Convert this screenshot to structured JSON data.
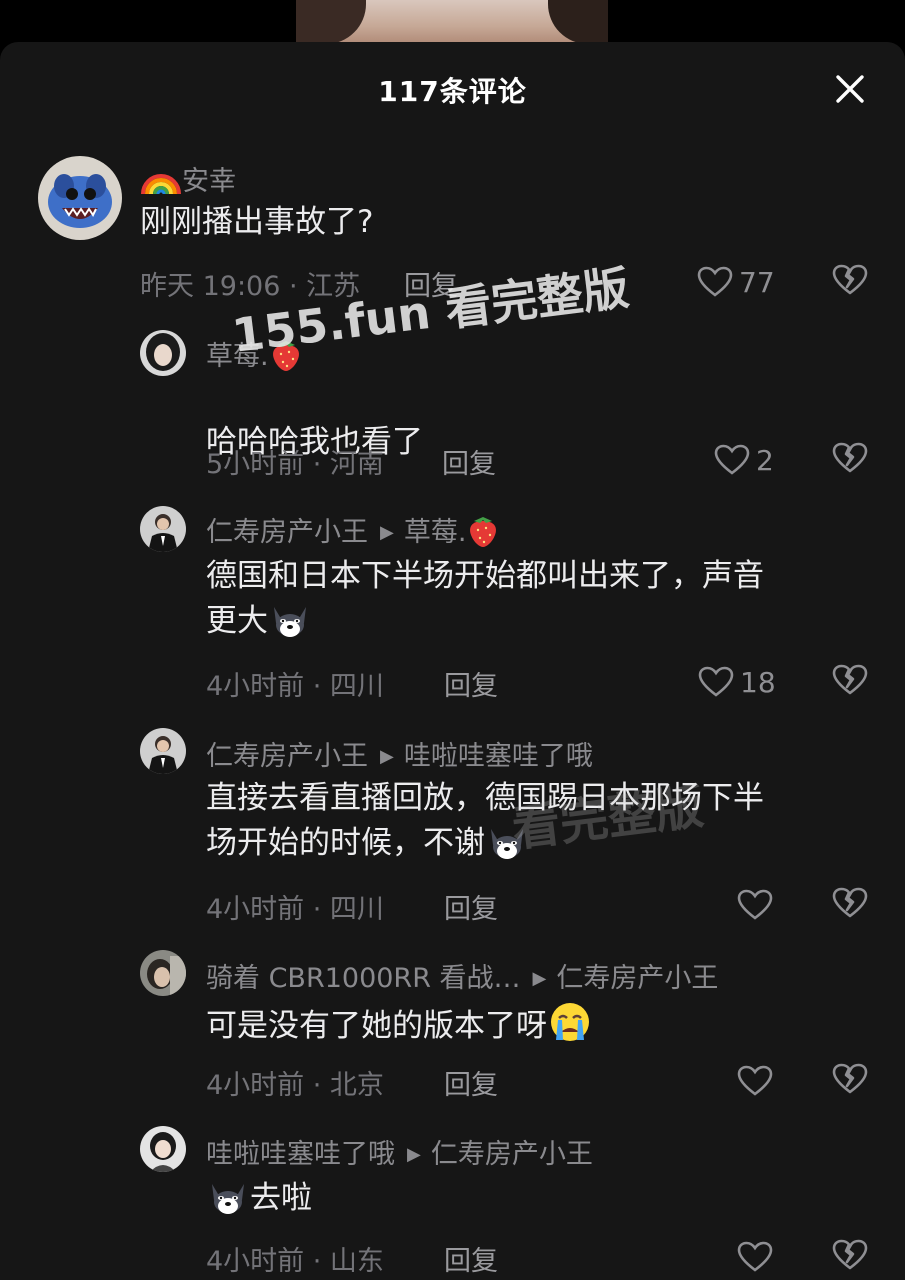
{
  "header": {
    "title": "117条评论"
  },
  "comments": [
    {
      "username": "安幸",
      "username_prefix_icon": "rainbow-icon",
      "text": "刚刚播出事故了?",
      "meta": "昨天 19:06 · 江苏",
      "reply_label": "回复",
      "likes": "77"
    },
    {
      "username": "草莓.",
      "username_suffix_icon": "strawberry-icon",
      "text": "哈哈哈我也看了",
      "meta": "5小时前 · 河南",
      "reply_label": "回复",
      "likes": "2"
    },
    {
      "username": "仁寿房产小王",
      "reply_to": "草莓.",
      "reply_to_suffix_icon": "strawberry-icon",
      "text_line1": "德国和日本下半场开始都叫出来了，声音",
      "text_line2": "更大",
      "emoji": "doge-icon",
      "meta": "4小时前 · 四川",
      "reply_label": "回复",
      "likes": "18"
    },
    {
      "username": "仁寿房产小王",
      "reply_to": "哇啦哇塞哇了哦",
      "text_line1": "直接去看直播回放，德国踢日本那场下半",
      "text_line2": "场开始的时候，不谢",
      "emoji": "doge-icon",
      "meta": "4小时前 · 四川",
      "reply_label": "回复",
      "likes": ""
    },
    {
      "username": "骑着 CBR1000RR 看战…",
      "reply_to": "仁寿房产小王",
      "text": "可是没有了她的版本了呀",
      "emoji": "crying-face-icon",
      "meta": "4小时前 · 北京",
      "reply_label": "回复",
      "likes": ""
    },
    {
      "username": "哇啦哇塞哇了哦",
      "reply_to": "仁寿房产小王",
      "emoji": "doge-icon",
      "text": "去啦",
      "meta": "4小时前 · 山东",
      "reply_label": "回复",
      "likes": ""
    }
  ],
  "watermark": {
    "text": "155.fun 看完整版",
    "faint_text": "看完整版"
  },
  "colors": {
    "sheet_bg": "#161616",
    "text": "#ececee",
    "muted": "#8a8a8e"
  }
}
